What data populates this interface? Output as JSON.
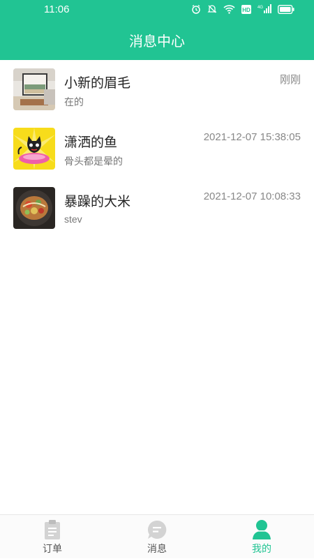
{
  "status_bar": {
    "time": "11:06",
    "icons": [
      "alarm-icon",
      "mute-icon",
      "wifi-icon",
      "hd-icon",
      "signal-icon",
      "battery-icon"
    ],
    "hd_label": "HD",
    "network_label": "4G"
  },
  "header": {
    "title": "消息中心"
  },
  "colors": {
    "accent": "#21c493",
    "tab_inactive": "#d7d7d7",
    "text_primary": "#222222",
    "text_secondary": "#888888"
  },
  "messages": [
    {
      "name": "小新的眉毛",
      "preview": "在的",
      "time": "刚刚",
      "avatar": "room-photo"
    },
    {
      "name": "潇洒的鱼",
      "preview": "骨头都是晕的",
      "time": "2021-12-07 15:38:05",
      "avatar": "cat-cartoon"
    },
    {
      "name": "暴躁的大米",
      "preview": "stev",
      "time": "2021-12-07 10:08:33",
      "avatar": "food-photo"
    }
  ],
  "tabs": [
    {
      "label": "订单",
      "icon": "clipboard-icon",
      "active": false
    },
    {
      "label": "消息",
      "icon": "chat-bubble-icon",
      "active": false
    },
    {
      "label": "我的",
      "icon": "person-icon",
      "active": true
    }
  ]
}
